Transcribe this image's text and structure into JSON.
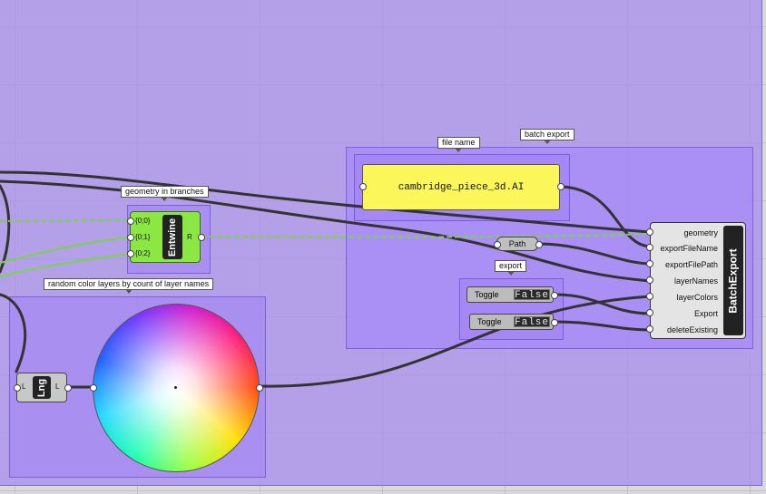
{
  "groups": {
    "file_name": "file name",
    "batch_export": "batch export",
    "export": "export",
    "branches": "geometry in branches",
    "color_layers": "random color layers by count of layer names"
  },
  "panel": {
    "text": "cambridge_piece_3d.AI"
  },
  "path_param": {
    "label": "Path"
  },
  "toggles": [
    {
      "label": "Toggle",
      "value": "False"
    },
    {
      "label": "Toggle",
      "value": "False"
    }
  ],
  "entwine": {
    "name": "Entwine",
    "inputs": [
      "{0;0}",
      "{0;1}",
      "{0;2}"
    ],
    "output": "R"
  },
  "lng": {
    "name": "Lng",
    "input": "L",
    "output": "L"
  },
  "batch_export": {
    "name": "BatchExport",
    "params": [
      "geometry",
      "exportFileName",
      "exportFilePath",
      "layerNames",
      "layerColors",
      "Export",
      "deleteExisting"
    ]
  },
  "colors": {
    "group_fill": "#a58ae8",
    "panel_fill": "#fbf65a",
    "entwine_fill": "#8be843",
    "wire": "#3a3a3a",
    "tree_wire": "#7ad44a"
  }
}
